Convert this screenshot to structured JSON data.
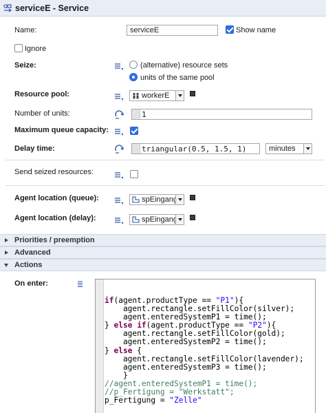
{
  "header": {
    "title": "serviceE - Service"
  },
  "name_row": {
    "label": "Name:",
    "value": "serviceE",
    "show_name_label": "Show name",
    "show_name_checked": true
  },
  "ignore": {
    "label": "Ignore",
    "checked": false
  },
  "seize": {
    "label": "Seize:",
    "option1": "(alternative) resource sets",
    "option2": "units of the same pool",
    "selected": 2
  },
  "resource_pool": {
    "label": "Resource pool:",
    "value": "workerE"
  },
  "units": {
    "label": "Number of units:",
    "value": "1"
  },
  "max_queue": {
    "label": "Maximum queue capacity:",
    "checked": true
  },
  "delay": {
    "label": "Delay time:",
    "value": "triangular(0.5, 1.5, 1)",
    "unit": "minutes"
  },
  "send_seized": {
    "label": "Send seized resources:",
    "checked": false
  },
  "loc_queue": {
    "label": "Agent location (queue):",
    "value": "spEingang"
  },
  "loc_delay": {
    "label": "Agent location (delay):",
    "value": "spEingang"
  },
  "sections": {
    "priorities": "Priorities / preemption",
    "advanced": "Advanced",
    "actions": "Actions"
  },
  "on_enter": {
    "label": "On enter:"
  },
  "code": {
    "l1_kw": "if",
    "l1_a": "(agent.productType == ",
    "l1_s": "\"P1\"",
    "l1_b": "){",
    "l2": "    agent.rectangle.setFillColor(silver);",
    "l3": "    agent.enteredSystemP1 = time();",
    "l4_a": "} ",
    "l4_kw1": "else",
    "l4_sp": " ",
    "l4_kw2": "if",
    "l4_b": "(agent.productType == ",
    "l4_s": "\"P2\"",
    "l4_c": "){",
    "l5": "    agent.rectangle.setFillColor(gold);",
    "l6": "    agent.enteredSystemP2 = time();",
    "l7_a": "} ",
    "l7_kw": "else",
    "l7_b": " {",
    "l8": "    agent.rectangle.setFillColor(lavender);",
    "l9": "    agent.enteredSystemP3 = time();",
    "l10": "    }",
    "l11": "//agent.enteredSystemP1 = time();",
    "l12_a": "//p_Fertigung = ",
    "l12_s": "\"Werkstatt\"",
    "l12_b": ";",
    "l13_a": "p_Fertigung = ",
    "l13_s": "\"Zelle\""
  },
  "colors": {
    "accent": "#2f6fe8",
    "section_bg": "#e9eef6",
    "keyword": "#7f0055",
    "string": "#2a00ff",
    "comment": "#3f7f5f"
  }
}
